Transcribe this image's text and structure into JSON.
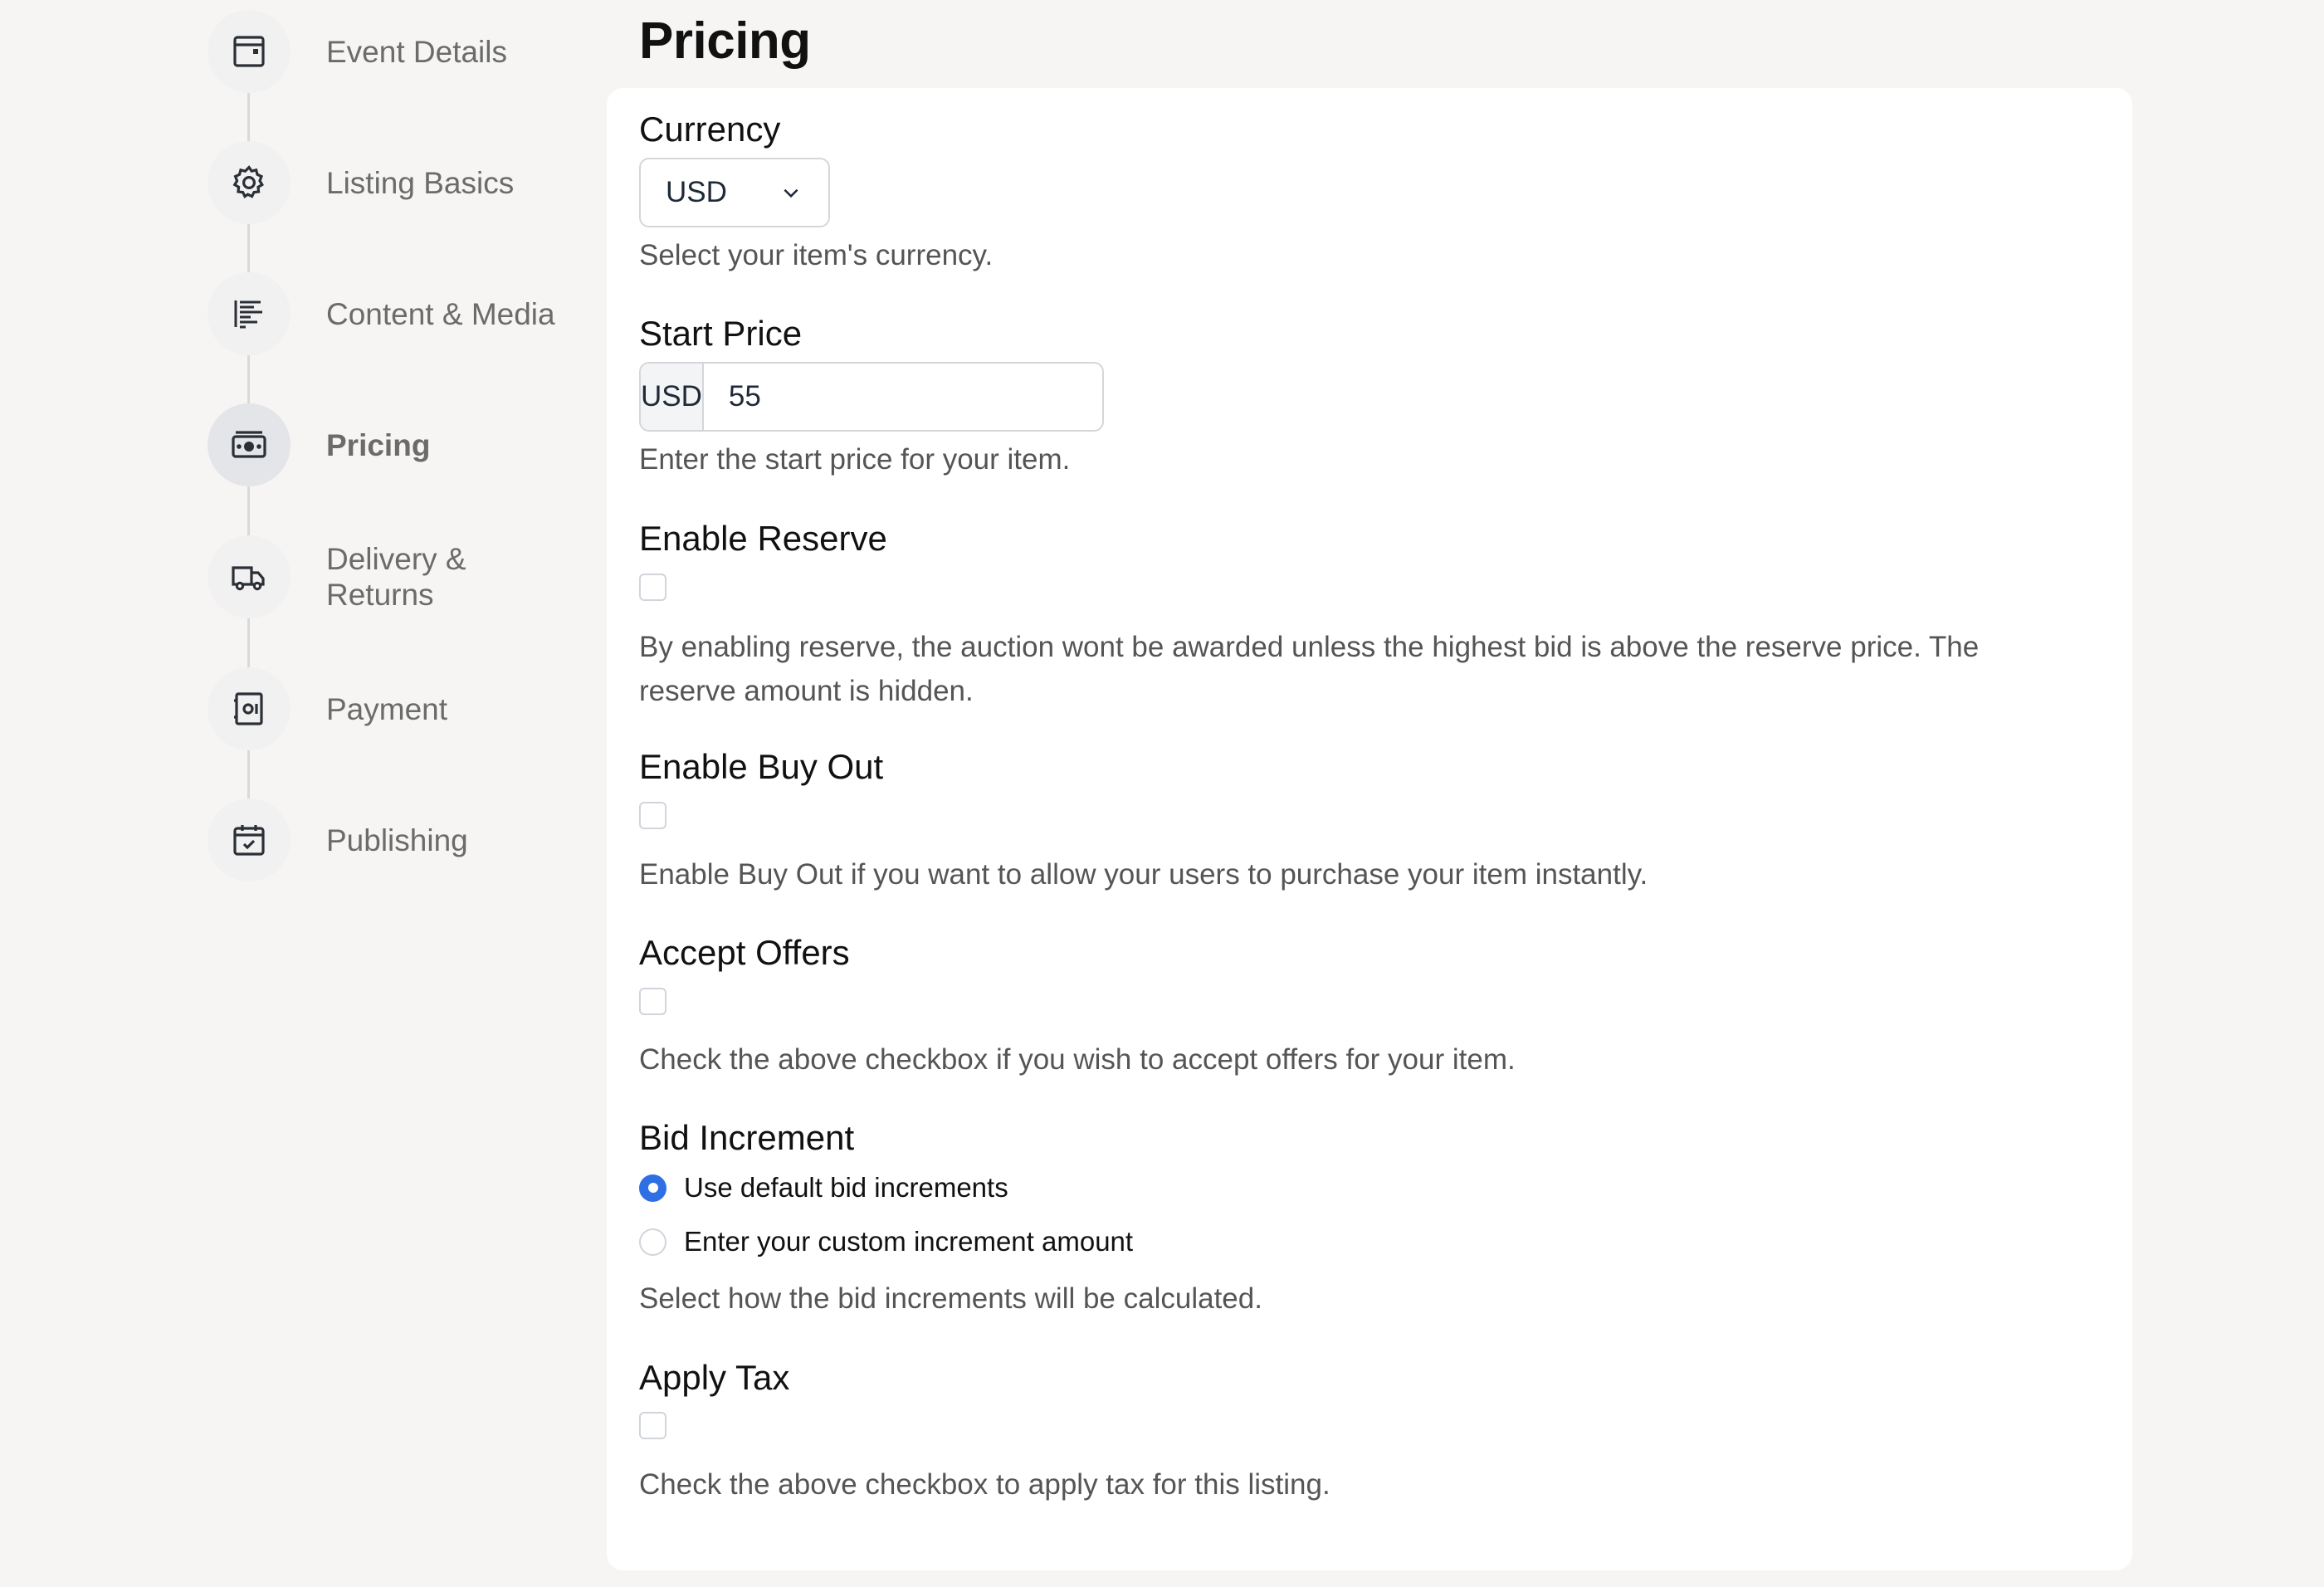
{
  "sidebar": {
    "steps": [
      {
        "label": "Event Details",
        "icon": "event-card-icon"
      },
      {
        "label": "Listing Basics",
        "icon": "gear-icon"
      },
      {
        "label": "Content & Media",
        "icon": "text-lines-icon"
      },
      {
        "label": "Pricing",
        "icon": "money-icon",
        "active": true
      },
      {
        "label": "Delivery & Returns",
        "icon": "truck-icon"
      },
      {
        "label": "Payment",
        "icon": "safe-icon"
      },
      {
        "label": "Publishing",
        "icon": "calendar-check-icon"
      }
    ]
  },
  "main": {
    "title": "Pricing",
    "currency": {
      "label": "Currency",
      "value": "USD",
      "help": "Select your item's currency."
    },
    "start_price": {
      "label": "Start Price",
      "addon": "USD",
      "value": "55",
      "help": "Enter the start price for your item."
    },
    "enable_reserve": {
      "label": "Enable Reserve",
      "checked": false,
      "help": "By enabling reserve, the auction wont be awarded unless the highest bid is above the reserve price. The reserve amount is hidden."
    },
    "enable_buy_out": {
      "label": "Enable Buy Out",
      "checked": false,
      "help": "Enable Buy Out if you want to allow your users to purchase your item instantly."
    },
    "accept_offers": {
      "label": "Accept Offers",
      "checked": false,
      "help": "Check the above checkbox if you wish to accept offers for your item."
    },
    "bid_increment": {
      "label": "Bid Increment",
      "options": [
        {
          "label": "Use default bid increments",
          "selected": true
        },
        {
          "label": "Enter your custom increment amount",
          "selected": false
        }
      ],
      "help": "Select how the bid increments will be calculated."
    },
    "apply_tax": {
      "label": "Apply Tax",
      "checked": false,
      "help": "Check the above checkbox to apply tax for this listing."
    }
  },
  "colors": {
    "page_bg": "#f6f5f4",
    "panel_bg": "#ffffff",
    "accent": "#2f6fe4",
    "muted_text": "#6b6b6b"
  }
}
